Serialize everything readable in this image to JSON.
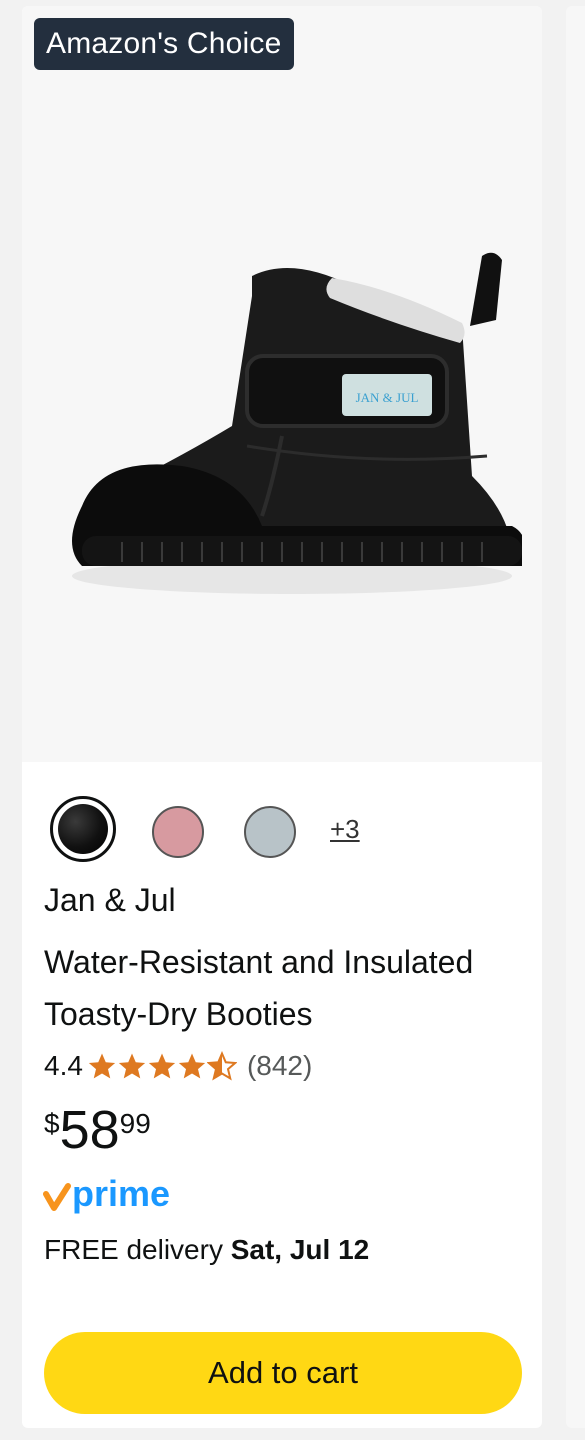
{
  "badge": {
    "label": "Amazon's Choice"
  },
  "product": {
    "image_alt": "Black toddler boot with fleece lining and velcro strap",
    "strap_logo": "JAN & JUL",
    "swatches": {
      "colors": [
        "#111111",
        "#d79aa0",
        "#b8c3c8"
      ],
      "selected": "black",
      "more_label": "+3"
    },
    "brand": "Jan & Jul",
    "title": "Water-Resistant and Insulated Toasty-Dry Booties",
    "rating": {
      "value": "4.4",
      "stars": 4.5,
      "count": "(842)"
    },
    "price": {
      "symbol": "$",
      "whole": "58",
      "fraction": "99"
    },
    "prime_label": "prime",
    "delivery": {
      "prefix": "FREE delivery",
      "date": "Sat, Jul 12"
    },
    "add_to_cart_label": "Add to cart"
  },
  "colors": {
    "badge_bg": "#232f3e",
    "button_bg": "#ffd814",
    "star": "#de7921",
    "prime_blue": "#1a98ff",
    "prime_check": "#f7941d"
  }
}
